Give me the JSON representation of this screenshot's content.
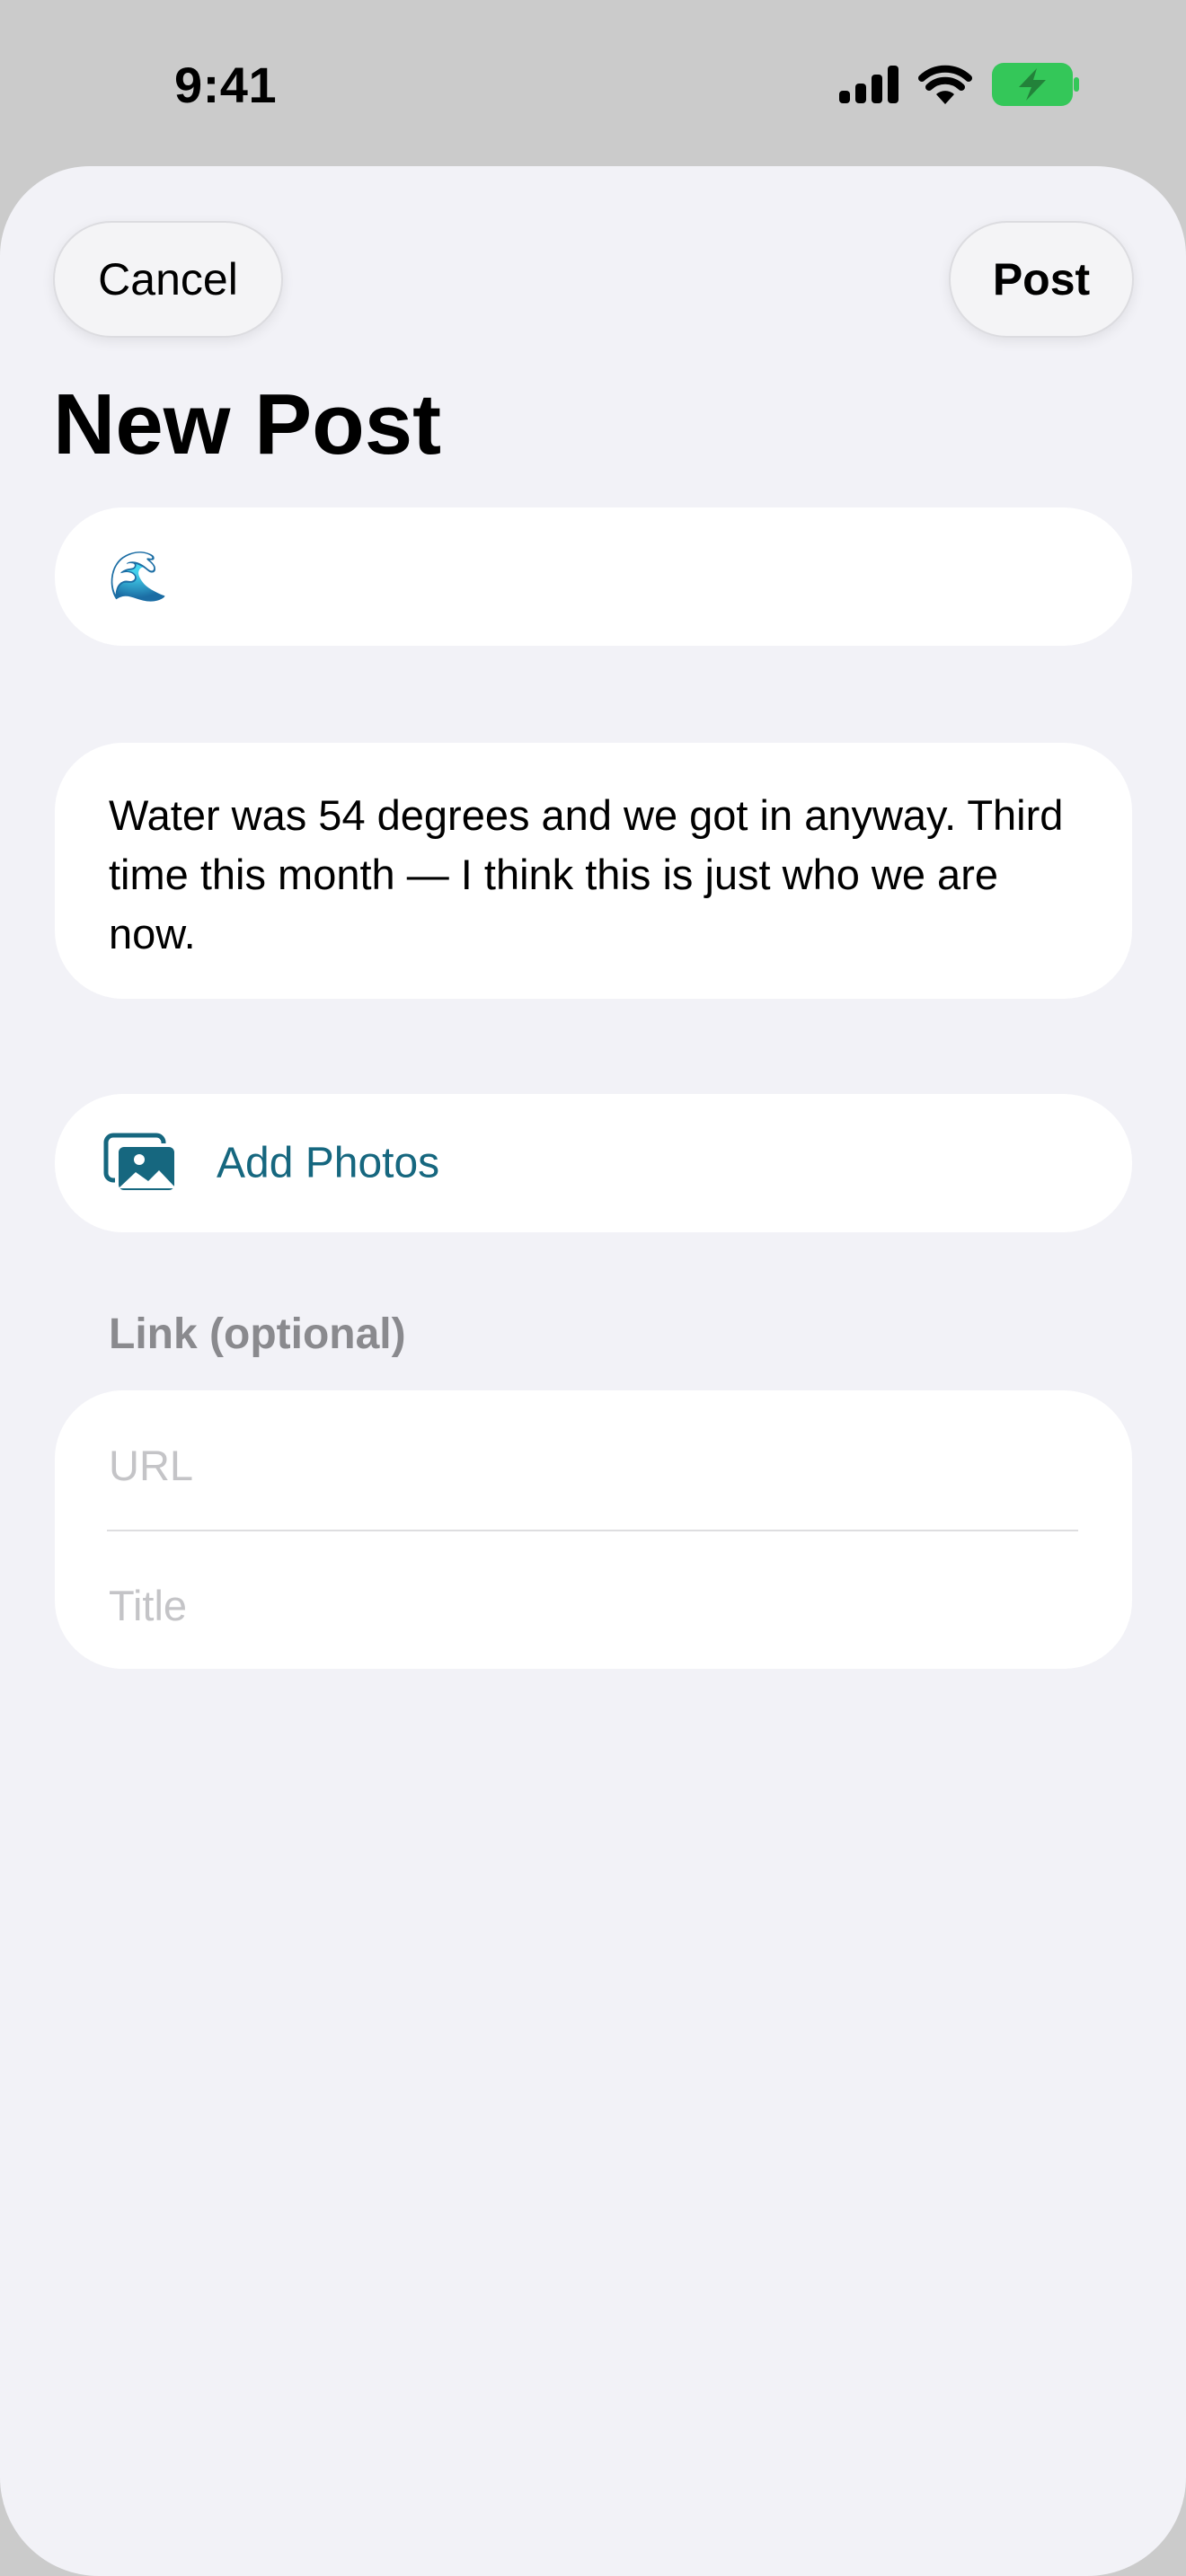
{
  "status_bar": {
    "time": "9:41",
    "battery_color": "#34c759"
  },
  "toolbar": {
    "cancel_label": "Cancel",
    "post_label": "Post"
  },
  "page": {
    "title": "New Post"
  },
  "composer": {
    "emoji": "🌊",
    "body_text": "Water was 54 degrees and we got in anyway. Third time this month — I think this is just who we are now."
  },
  "photos": {
    "label": "Add Photos",
    "icon": "photo-stack-icon",
    "accent_color": "#16677f"
  },
  "link_section": {
    "label": "Link (optional)",
    "url_placeholder": "URL",
    "title_placeholder": "Title"
  }
}
